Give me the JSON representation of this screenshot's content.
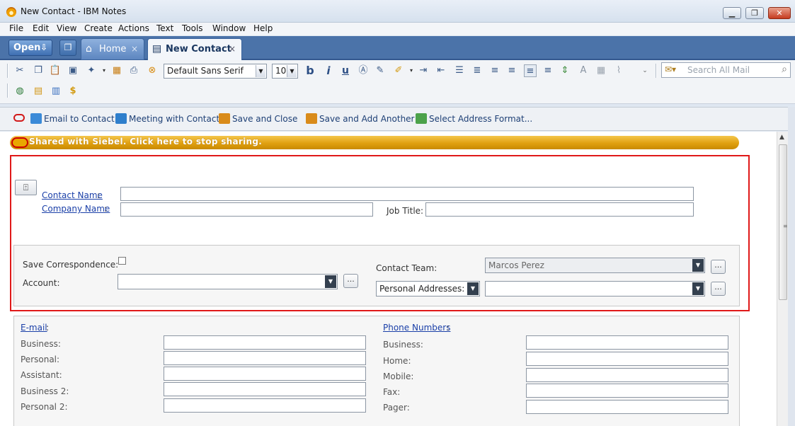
{
  "window": {
    "title": "New Contact - IBM Notes",
    "minimize_glyph": "▁",
    "maximize_glyph": "❐",
    "close_glyph": "✕"
  },
  "menu": [
    "File",
    "Edit",
    "View",
    "Create",
    "Actions",
    "Text",
    "Tools",
    "Window",
    "Help"
  ],
  "tabs": {
    "open_label": "Open",
    "open_arrow": "⇩",
    "home": {
      "label": "Home",
      "icon": "⌂",
      "close": "×"
    },
    "active": {
      "label": "New Contact",
      "icon": "▤",
      "close": "×"
    }
  },
  "toolbar": {
    "font_name": "Default Sans Serif",
    "font_size": "10",
    "bold": "b",
    "italic": "i",
    "underline": "u",
    "search_placeholder": "Search All Mail",
    "icons": [
      "cut-icon",
      "copy-icon",
      "paste-icon",
      "paste-special-icon",
      "new-icon",
      "save-icon",
      "print-icon",
      "cancel-icon",
      "text-color-icon",
      "highlight-icon",
      "bullets-icon",
      "numbering-icon",
      "align-icon",
      "attach-icon",
      "globe-icon",
      "note-icon",
      "database-icon",
      "coins-icon"
    ]
  },
  "actions": [
    {
      "label": "Email to Contact",
      "color": "#3a8ad8"
    },
    {
      "label": "Meeting with Contact",
      "color": "#2f7fcc"
    },
    {
      "label": "Save and Close",
      "color": "#d98b1a"
    },
    {
      "label": "Save and Add Another",
      "color": "#d98b1a"
    },
    {
      "label": "Select Address Format...",
      "color": "#4ca24a"
    }
  ],
  "sharing_banner": "Shared with Siebel. Click here to stop sharing.",
  "contact": {
    "contact_name_label": "Contact Name",
    "company_name_label": "Company Name",
    "job_title_label": "Job Title:",
    "save_correspondence_label": "Save Correspondence:",
    "account_label": "Account:",
    "contact_team_label": "Contact Team:",
    "contact_team_value": "Marcos Perez",
    "personal_addresses_label": "Personal Addresses:",
    "ellipsis": "..."
  },
  "email": {
    "heading": "E-mail",
    "fields": [
      "Business:",
      "Personal:",
      "Assistant:",
      "Business 2:",
      "Personal 2:"
    ]
  },
  "phone": {
    "heading": "Phone Numbers",
    "fields": [
      "Business:",
      "Home:",
      "Mobile:",
      "Fax:",
      "Pager:"
    ]
  },
  "colors": {
    "accent_blue": "#4b73a9",
    "banner_gold": "#e0a010",
    "frame_red": "#e01919",
    "link_blue": "#1a3fa8"
  }
}
